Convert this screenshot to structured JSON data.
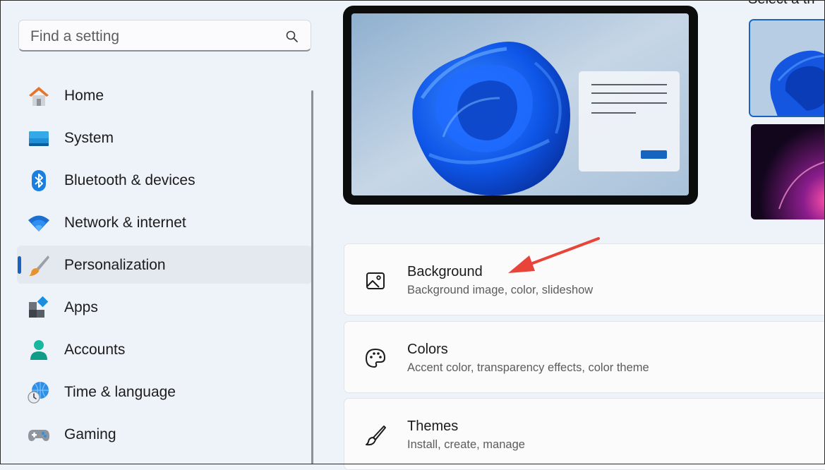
{
  "search": {
    "placeholder": "Find a setting",
    "icon": "search-icon"
  },
  "sidebar": {
    "items": [
      {
        "label": "Home",
        "icon": "home-icon",
        "selected": false
      },
      {
        "label": "System",
        "icon": "system-icon",
        "selected": false
      },
      {
        "label": "Bluetooth & devices",
        "icon": "bluetooth-icon",
        "selected": false
      },
      {
        "label": "Network & internet",
        "icon": "wifi-icon",
        "selected": false
      },
      {
        "label": "Personalization",
        "icon": "paintbrush-icon",
        "selected": true
      },
      {
        "label": "Apps",
        "icon": "apps-icon",
        "selected": false
      },
      {
        "label": "Accounts",
        "icon": "person-icon",
        "selected": false
      },
      {
        "label": "Time & language",
        "icon": "globe-clock-icon",
        "selected": false
      },
      {
        "label": "Gaming",
        "icon": "gamepad-icon",
        "selected": false
      }
    ]
  },
  "theme_section": {
    "heading_peek": "Select a th"
  },
  "cards": [
    {
      "title": "Background",
      "subtitle": "Background image, color, slideshow",
      "icon": "image-icon"
    },
    {
      "title": "Colors",
      "subtitle": "Accent color, transparency effects, color theme",
      "icon": "palette-icon"
    },
    {
      "title": "Themes",
      "subtitle": "Install, create, manage",
      "icon": "brush-icon"
    }
  ],
  "colors": {
    "accent": "#1764c0",
    "annotation_arrow": "#e8443a"
  }
}
